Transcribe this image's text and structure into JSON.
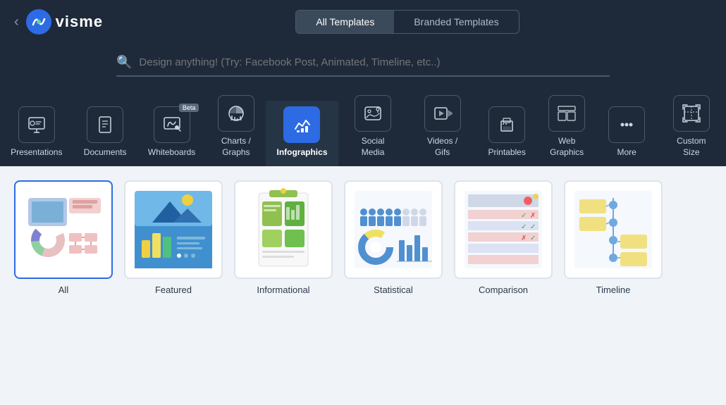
{
  "header": {
    "back_icon": "‹",
    "logo_text": "visme",
    "tabs": [
      {
        "label": "All Templates",
        "active": true
      },
      {
        "label": "Branded Templates",
        "active": false
      }
    ]
  },
  "search": {
    "placeholder": "Design anything! (Try: Facebook Post, Animated, Timeline, etc..)"
  },
  "categories": [
    {
      "id": "presentations",
      "label": "Presentations",
      "active": false,
      "beta": false,
      "icon": "presentation"
    },
    {
      "id": "documents",
      "label": "Documents",
      "active": false,
      "beta": false,
      "icon": "document"
    },
    {
      "id": "whiteboards",
      "label": "Whiteboards",
      "active": false,
      "beta": true,
      "icon": "whiteboard"
    },
    {
      "id": "charts-graphs",
      "label": "Charts /\nGraphs",
      "active": false,
      "beta": false,
      "icon": "chart"
    },
    {
      "id": "infographics",
      "label": "Infographics",
      "active": true,
      "beta": false,
      "icon": "infographic"
    },
    {
      "id": "social-media",
      "label": "Social Media",
      "active": false,
      "beta": false,
      "icon": "social"
    },
    {
      "id": "videos-gifs",
      "label": "Videos / Gifs",
      "active": false,
      "beta": false,
      "icon": "video"
    },
    {
      "id": "printables",
      "label": "Printables",
      "active": false,
      "beta": false,
      "icon": "print"
    },
    {
      "id": "web-graphics",
      "label": "Web\nGraphics",
      "active": false,
      "beta": false,
      "icon": "web"
    },
    {
      "id": "more",
      "label": "More",
      "active": false,
      "beta": false,
      "icon": "more"
    },
    {
      "id": "custom-size",
      "label": "Custom Size",
      "active": false,
      "beta": false,
      "icon": "custom"
    }
  ],
  "templates": [
    {
      "id": "all",
      "label": "All",
      "selected": true
    },
    {
      "id": "featured",
      "label": "Featured",
      "selected": false
    },
    {
      "id": "informational",
      "label": "Informational",
      "selected": false
    },
    {
      "id": "statistical",
      "label": "Statistical",
      "selected": false
    },
    {
      "id": "comparison",
      "label": "Comparison",
      "selected": false
    },
    {
      "id": "timeline",
      "label": "Timeline",
      "selected": false
    }
  ]
}
